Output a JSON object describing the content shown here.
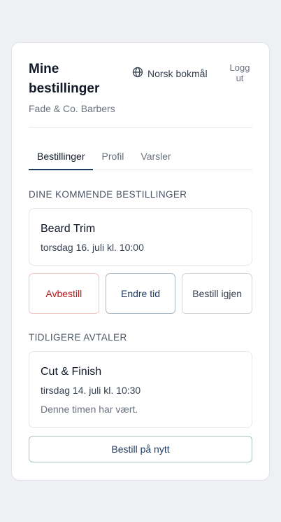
{
  "header": {
    "title": "Mine bestillinger",
    "subtitle": "Fade & Co. Barbers",
    "language_label": "Norsk bokmål",
    "logout_label": "Logg ut"
  },
  "tabs": [
    {
      "label": "Bestillinger",
      "active": true
    },
    {
      "label": "Profil",
      "active": false
    },
    {
      "label": "Varsler",
      "active": false
    }
  ],
  "upcoming": {
    "section_label": "DINE KOMMENDE BESTILLINGER",
    "service": "Beard Trim",
    "datetime": "torsdag 16. juli kl. 10:00",
    "actions": {
      "cancel_label": "Avbestill",
      "change_label": "Endre tid",
      "book_again_label": "Bestill igjen"
    }
  },
  "past": {
    "section_label": "TIDLIGERE AVTALER",
    "service": "Cut & Finish",
    "datetime": "tirsdag 14. juli kl. 10:30",
    "note": "Denne timen har vært.",
    "rebook_label": "Bestill på nytt"
  },
  "colors": {
    "accent": "#1f3a5f",
    "danger": "#b91c1c",
    "background": "#eef0f3"
  },
  "icons": {
    "language": "globe-icon"
  }
}
